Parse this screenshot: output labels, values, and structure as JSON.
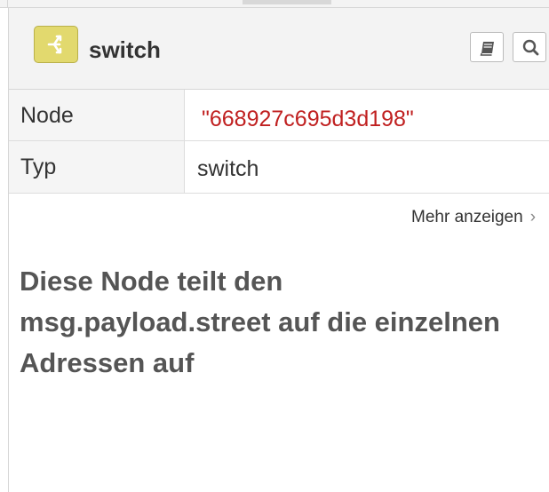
{
  "header": {
    "title": "switch",
    "icon": "switch-node-icon",
    "icon_color": "#e2d96e",
    "buttons": [
      {
        "icon": "book-icon"
      },
      {
        "icon": "search-icon"
      }
    ]
  },
  "info": {
    "rows": [
      {
        "key": "Node",
        "value": "\"668927c695d3d198\"",
        "value_color": "#c02020"
      },
      {
        "key": "Typ",
        "value": "switch"
      }
    ]
  },
  "more_link": {
    "label": "Mehr anzeigen"
  },
  "description": {
    "text": "Diese Node teilt den msg.payload.street auf die einzelnen Adressen auf"
  }
}
